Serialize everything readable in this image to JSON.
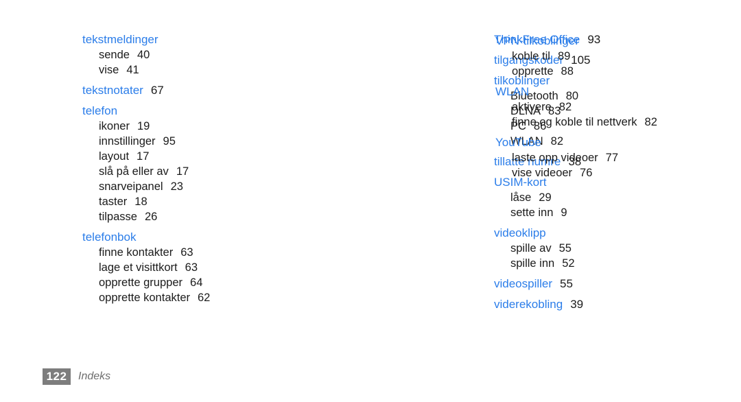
{
  "document": {
    "page_number": "122",
    "footer_label": "Indeks",
    "heading_color": "#2b7de9",
    "text_color": "#1b1b1b",
    "page_box_color": "#7d7d7d",
    "background_color": "#ffffff"
  },
  "columns": [
    {
      "id": "column-1",
      "groups": [
        {
          "heading": "tekstmeldinger",
          "heading_page": "",
          "subentries": [
            {
              "label": "sende",
              "page": "40"
            },
            {
              "label": "vise",
              "page": "41"
            }
          ]
        },
        {
          "heading": "tekstnotater",
          "heading_page": "67",
          "subentries": []
        },
        {
          "heading": "telefon",
          "heading_page": "",
          "subentries": [
            {
              "label": "ikoner",
              "page": "19"
            },
            {
              "label": "innstillinger",
              "page": "95"
            },
            {
              "label": "layout",
              "page": "17"
            },
            {
              "label": "slå på eller av",
              "page": "17"
            },
            {
              "label": "snarveipanel",
              "page": "23"
            },
            {
              "label": "taster",
              "page": "18"
            },
            {
              "label": "tilpasse",
              "page": "26"
            }
          ]
        },
        {
          "heading": "telefonbok",
          "heading_page": "",
          "subentries": [
            {
              "label": "finne kontakter",
              "page": "63"
            },
            {
              "label": "lage et visittkort",
              "page": "63"
            },
            {
              "label": "opprette grupper",
              "page": "64"
            },
            {
              "label": "opprette kontakter",
              "page": "62"
            }
          ]
        }
      ]
    },
    {
      "id": "column-2",
      "groups": [
        {
          "heading": "ThinkFree Office",
          "heading_page": "93",
          "subentries": []
        },
        {
          "heading": "tilgangskoder",
          "heading_page": "105",
          "subentries": []
        },
        {
          "heading": "tilkoblinger",
          "heading_page": "",
          "subentries": [
            {
              "label": "Bluetooth",
              "page": "80"
            },
            {
              "label": "DLNA",
              "page": "83"
            },
            {
              "label": "PC",
              "page": "86"
            },
            {
              "label": "WLAN",
              "page": "82"
            }
          ]
        },
        {
          "heading": "tillatte numre",
          "heading_page": "38",
          "subentries": []
        },
        {
          "heading": "USIM-kort",
          "heading_page": "",
          "subentries": [
            {
              "label": "låse",
              "page": "29"
            },
            {
              "label": "sette inn",
              "page": "9"
            }
          ]
        },
        {
          "heading": "videoklipp",
          "heading_page": "",
          "subentries": [
            {
              "label": "spille av",
              "page": "55"
            },
            {
              "label": "spille inn",
              "page": "52"
            }
          ]
        },
        {
          "heading": "videospiller",
          "heading_page": "55",
          "subentries": []
        },
        {
          "heading": "viderekobling",
          "heading_page": "39",
          "subentries": []
        }
      ]
    },
    {
      "id": "column-3",
      "groups": [
        {
          "heading": "VPN-tilkoblinger",
          "heading_page": "",
          "subentries": [
            {
              "label": "koble til",
              "page": "89"
            },
            {
              "label": "opprette",
              "page": "88"
            }
          ]
        },
        {
          "heading": "WLAN",
          "heading_page": "",
          "subentries": [
            {
              "label": "aktivere",
              "page": "82"
            },
            {
              "label": "finne og koble til nettverk",
              "page": "82"
            }
          ]
        },
        {
          "heading": "YouTube",
          "heading_page": "",
          "subentries": [
            {
              "label": "laste opp videoer",
              "page": "77"
            },
            {
              "label": "vise videoer",
              "page": "76"
            }
          ]
        }
      ]
    }
  ]
}
